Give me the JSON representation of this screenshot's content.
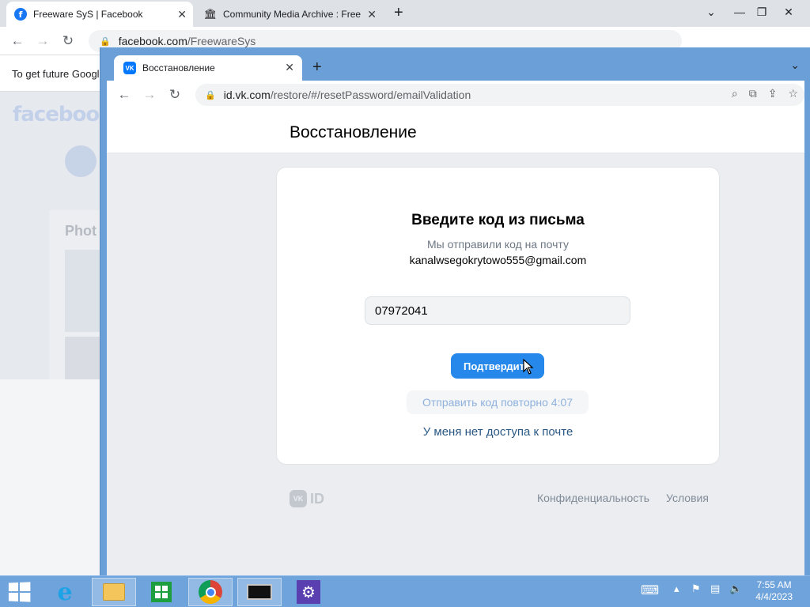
{
  "back_window": {
    "tabs": [
      {
        "title": "Freeware SyS | Facebook",
        "icon": "facebook-icon"
      },
      {
        "title": "Community Media Archive : Free",
        "icon": "archive-icon"
      }
    ],
    "url_domain": "facebook.com",
    "url_path": "/FreewareSys",
    "info_bar_text": "To get future Google",
    "page_logo": "facebook",
    "photos_heading": "Phot"
  },
  "front_window": {
    "tab_title": "Восстановление",
    "tab_icon": "vk-icon",
    "url_domain": "id.vk.com",
    "url_path": "/restore/#/resetPassword/emailValidation"
  },
  "page": {
    "header_title": "Восстановление",
    "card": {
      "heading": "Введите код из письма",
      "subtitle": "Мы отправили код на почту",
      "email": "kanalwsegokrytowo555@gmail.com",
      "code_value": "07972041",
      "confirm_label": "Подтвердить",
      "resend_label": "Отправить код повторно 4:07",
      "no_access_label": "У меня нет доступа к почте"
    },
    "footer": {
      "logo_text": "ID",
      "logo_badge": "VK",
      "privacy_label": "Конфиденциальность",
      "terms_label": "Условия"
    }
  },
  "taskbar": {
    "items": [
      "start-button",
      "internet-explorer-icon",
      "file-explorer-icon",
      "store-icon",
      "chrome-icon",
      "terminal-icon",
      "settings-icon"
    ],
    "clock_time": "7:55 AM",
    "clock_date": "4/4/2023"
  },
  "colors": {
    "vk_blue": "#2688eb",
    "link_blue": "#2a5885",
    "taskbar": "#6fa3db",
    "window_frame": "#6a9fd8"
  }
}
